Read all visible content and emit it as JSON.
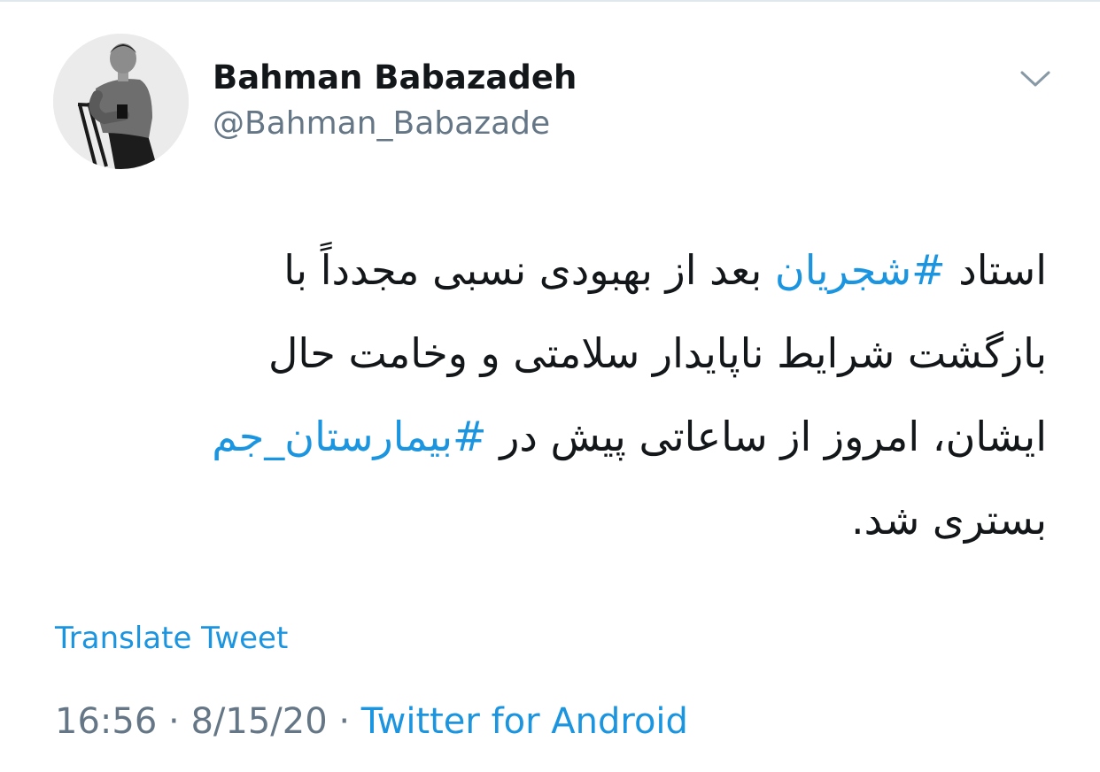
{
  "user": {
    "display_name": "Bahman Babazadeh",
    "handle": "@Bahman_Babazade",
    "avatar_icon": "person-seated-photo"
  },
  "tweet": {
    "lines": [
      [
        {
          "text": "استاد ",
          "hashtag": false
        },
        {
          "text": "#شجریان",
          "hashtag": true
        },
        {
          "text": " بعد از بهبودی نسبی مجدداً با",
          "hashtag": false
        }
      ],
      [
        {
          "text": "بازگشت شرایط ناپایدار سلامتی و وخامت حال",
          "hashtag": false
        }
      ],
      [
        {
          "text": "ایشان، امروز از ساعاتی پیش در ",
          "hashtag": false
        },
        {
          "text": "#بیمارستان_جم",
          "hashtag": true
        }
      ],
      [
        {
          "text": "بستری شد.",
          "hashtag": false
        }
      ]
    ]
  },
  "actions": {
    "translate_label": "Translate Tweet",
    "menu_icon": "chevron-down-icon"
  },
  "meta": {
    "time": "16:56",
    "separator": "·",
    "date": "8/15/20",
    "source": "Twitter for Android"
  },
  "colors": {
    "link": "#1b95e0",
    "secondary_text": "#657786",
    "primary_text": "#14171a",
    "divider": "#e1e8ed"
  }
}
